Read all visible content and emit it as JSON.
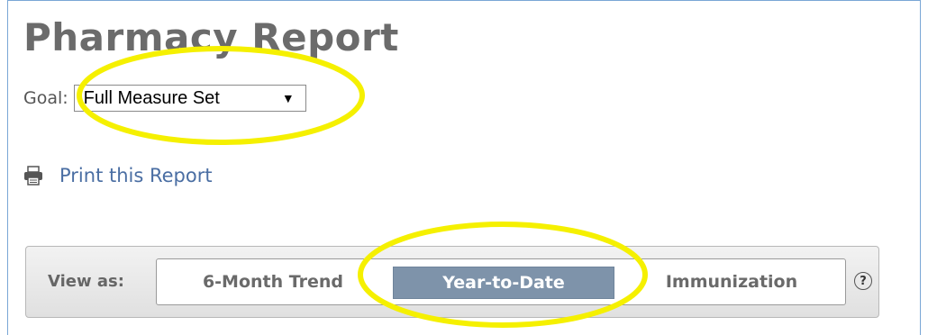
{
  "page": {
    "title": "Pharmacy Report"
  },
  "goal": {
    "label": "Goal:",
    "selected": "Full Measure Set"
  },
  "print": {
    "label": "Print this Report"
  },
  "view": {
    "label": "View as:",
    "options": [
      "6-Month Trend",
      "Year-to-Date",
      "Immunization"
    ],
    "active": "Year-to-Date"
  },
  "help": {
    "glyph": "?"
  },
  "colors": {
    "title": "#6b6b6b",
    "link": "#4a6ea3",
    "active_tab": "#7e93aa",
    "highlight": "#f5f000",
    "frame": "#7aa7d6"
  },
  "icons": [
    "printer-icon",
    "help-icon",
    "chevron-down-icon"
  ]
}
